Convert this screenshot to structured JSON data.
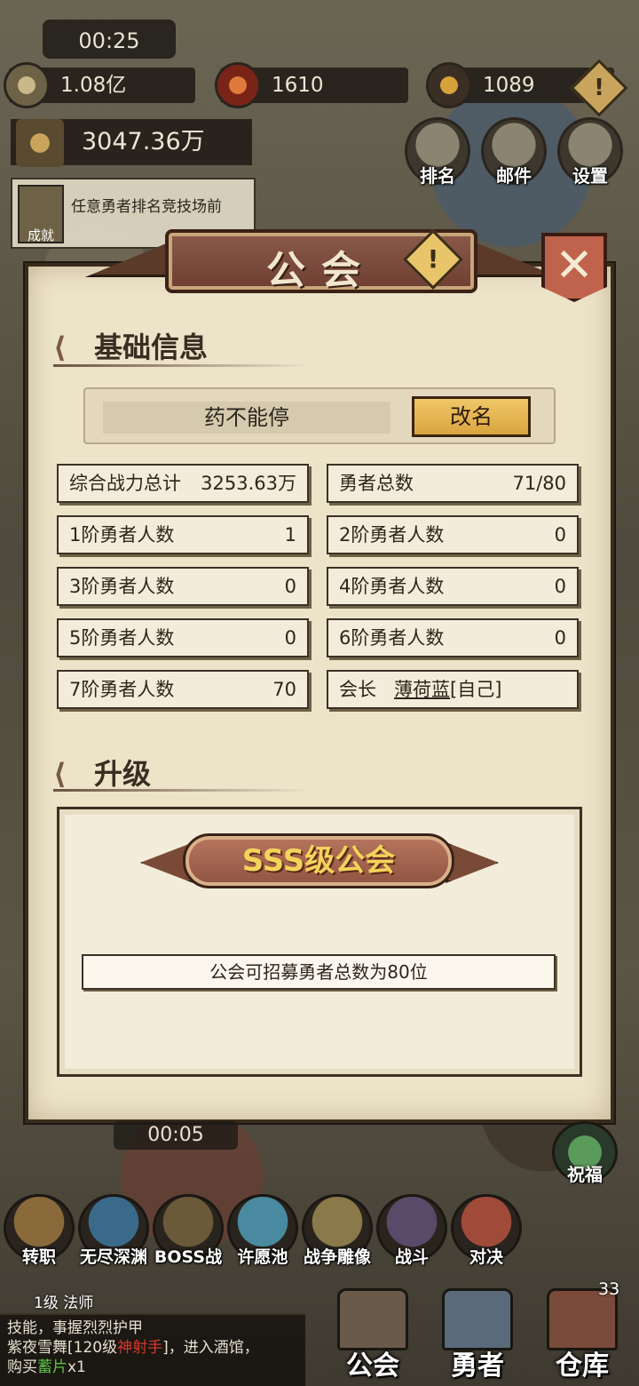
{
  "hud": {
    "timer_top": "00:25",
    "gold": "1.08亿",
    "gems": "1610",
    "crystals": "1089",
    "warning_glyph": "!",
    "power": "3047.36万",
    "quest_label": "成就",
    "quest_text": "任意勇者排名竞技场前",
    "top_menu": [
      {
        "label": "排名",
        "icon": "ranking-icon"
      },
      {
        "label": "邮件",
        "icon": "mail-icon"
      },
      {
        "label": "设置",
        "icon": "settings-icon"
      }
    ],
    "timer_bottom": "00:05",
    "bless_label": "祝福"
  },
  "guild_modal": {
    "title": "公会",
    "warning_glyph": "!",
    "close_glyph": "✕",
    "basic_info": {
      "heading": "基础信息",
      "guild_name": "药不能停",
      "rename_label": "改名",
      "stats": [
        {
          "label": "综合战力总计",
          "value": "3253.63万"
        },
        {
          "label": "勇者总数",
          "value": "71/80"
        },
        {
          "label": "1阶勇者人数",
          "value": "1"
        },
        {
          "label": "2阶勇者人数",
          "value": "0"
        },
        {
          "label": "3阶勇者人数",
          "value": "0"
        },
        {
          "label": "4阶勇者人数",
          "value": "0"
        },
        {
          "label": "5阶勇者人数",
          "value": "0"
        },
        {
          "label": "6阶勇者人数",
          "value": "0"
        },
        {
          "label": "7阶勇者人数",
          "value": "70"
        }
      ],
      "leader_label": "会长",
      "leader_name": "薄荷蓝",
      "leader_suffix": "[自己]"
    },
    "upgrade": {
      "heading": "升级",
      "grade": "SSS级公会",
      "description": "公会可招募勇者总数为80位"
    }
  },
  "features": [
    {
      "label": "转职",
      "color": "#8a6a3a"
    },
    {
      "label": "无尽深渊",
      "color": "#3a6a8a"
    },
    {
      "label": "BOSS战",
      "color": "#6a5a3a"
    },
    {
      "label": "许愿池",
      "color": "#4a8aa0"
    },
    {
      "label": "战争雕像",
      "color": "#8a7a4a"
    },
    {
      "label": "战斗",
      "color": "#5a4a6a"
    },
    {
      "label": "对决",
      "color": "#a04a3a"
    }
  ],
  "character_label": "1级 法师",
  "chat": {
    "line1": "技能，事握烈烈护甲",
    "line2_pre": "紫夜雪舞[120级",
    "line2_red": "神射手",
    "line2_post": "]，进入酒馆，",
    "line3_pre": "购买",
    "line3_green": "蓄片",
    "line3_post": "x1"
  },
  "bottom_tabs": [
    {
      "label": "公会"
    },
    {
      "label": "勇者"
    },
    {
      "label": "仓库"
    }
  ],
  "warehouse_badge": "33"
}
